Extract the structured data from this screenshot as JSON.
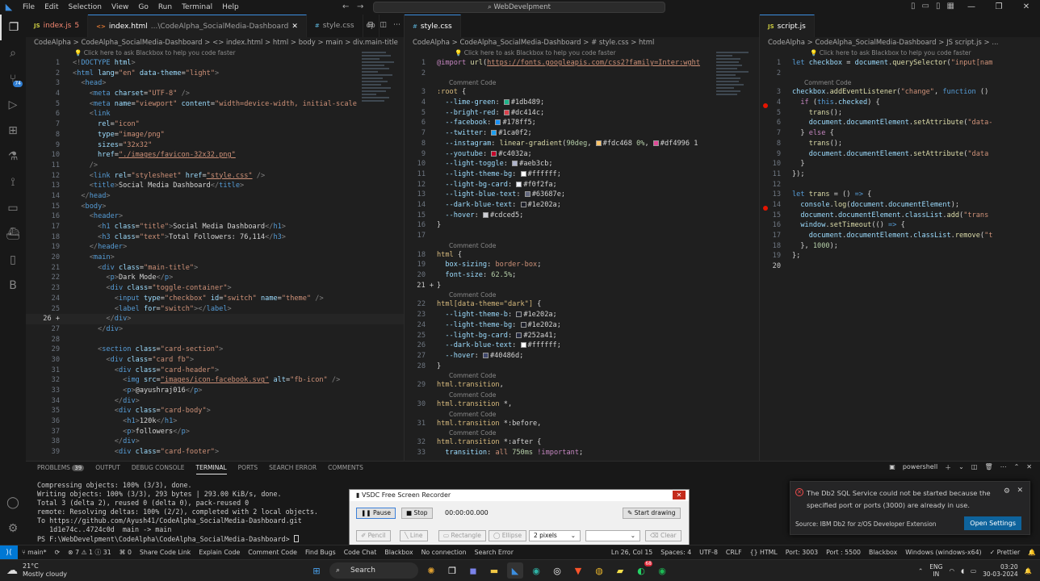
{
  "titlebar": {
    "menu": [
      "File",
      "Edit",
      "Selection",
      "View",
      "Go",
      "Run",
      "Terminal",
      "Help"
    ],
    "search": "WebDevelpment"
  },
  "editors": {
    "left": {
      "tabs": [
        {
          "name": "index.js",
          "badge": "5",
          "icon": "JS",
          "active": false
        },
        {
          "name": "index.html",
          "path": "...\\CodeAlpha_SocialMedia-Dashboard",
          "icon": "<>",
          "active": true
        },
        {
          "name": "style.css",
          "icon": "#",
          "active": false
        },
        {
          "name": "op",
          "icon": "",
          "active": false
        }
      ],
      "breadcrumb": "CodeAlpha > CodeAlpha_SocialMedia-Dashboard > <> index.html > html > body > main > div.main-title",
      "hint": "Click here to ask Blackbox to help you code faster"
    },
    "middle": {
      "tab": "style.css",
      "breadcrumb": "CodeAlpha > CodeAlpha_SocialMedia-Dashboard > # style.css > html",
      "hint": "Click here to ask Blackbox to help you code faster"
    },
    "right": {
      "tab": "script.js",
      "breadcrumb": "CodeAlpha > CodeAlpha_SocialMedia-Dashboard > JS script.js > ...",
      "hint": "Click here to ask Blackbox to help you code faster"
    },
    "comment_code": "Comment Code"
  },
  "panel": {
    "tabs": [
      {
        "label": "PROBLEMS",
        "count": "39"
      },
      {
        "label": "OUTPUT"
      },
      {
        "label": "DEBUG CONSOLE"
      },
      {
        "label": "TERMINAL",
        "active": true
      },
      {
        "label": "PORTS"
      },
      {
        "label": "SEARCH ERROR"
      },
      {
        "label": "COMMENTS"
      }
    ],
    "shell": "powershell",
    "terminal_lines": [
      "Compressing objects: 100% (3/3), done.",
      "Writing objects: 100% (3/3), 293 bytes | 293.00 KiB/s, done.",
      "Total 3 (delta 2), reused 0 (delta 0), pack-reused 0",
      "remote: Resolving deltas: 100% (2/2), completed with 2 local objects.",
      "To https://github.com/Ayush41/CodeAlpha_SocialMedia-Dashboard.git",
      "   1d1e74c..4724c0d  main -> main",
      "PS F:\\WebDevelpment\\CodeAlpha\\CodeAlpha_SocialMedia-Dashboard> "
    ]
  },
  "recorder": {
    "title": "VSDC Free Screen Recorder",
    "pause": "Pause",
    "stop": "Stop",
    "time": "00:00:00.000",
    "start_drawing": "Start drawing",
    "pencil": "Pencil",
    "line": "Line",
    "rectangle": "Rectangle",
    "ellipse": "Ellipse",
    "pixels": "2 pixels",
    "clear": "Clear"
  },
  "notification": {
    "message": "The Db2 SQL Service could not be started because the specified port or ports (3000) are already in use.",
    "source": "Source: IBM Db2 for z/OS Developer Extension",
    "button": "Open Settings"
  },
  "statusbar": {
    "left": [
      "main*",
      "⊗ 7 ⚠ 1 ⓘ 31",
      "⌘ 0",
      "Share Code Link",
      "Explain Code",
      "Comment Code",
      "Find Bugs",
      "Code Chat",
      "Blackbox",
      "No connection",
      "Search Error"
    ],
    "right": [
      "Ln 26, Col 15",
      "Spaces: 4",
      "UTF-8",
      "CRLF",
      "{} HTML",
      "Port: 3003",
      "Port : 5500",
      "Blackbox",
      "Windows (windows-x64)",
      "✓ Prettier"
    ]
  },
  "taskbar": {
    "temp": "21°C",
    "weather": "Mostly cloudy",
    "search": "Search",
    "lang": "ENG",
    "region": "IN",
    "time": "03:20",
    "date": "30-03-2024",
    "badge": "68"
  }
}
